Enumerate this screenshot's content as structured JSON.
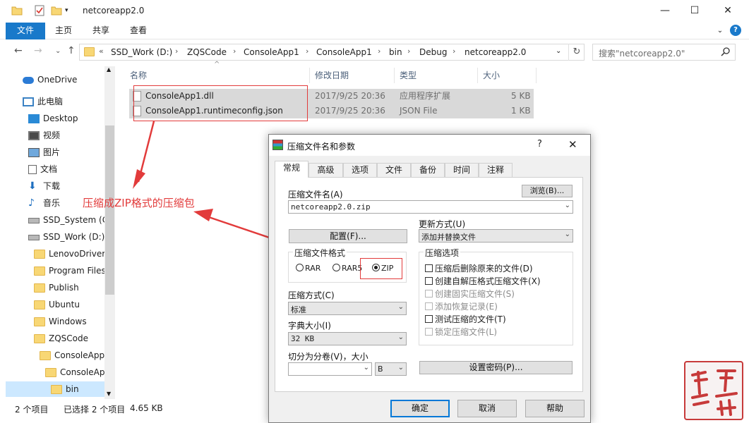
{
  "window": {
    "title": "netcoreapp2.0",
    "controls": {
      "minimize": "—",
      "maximize": "☐",
      "close": "✕"
    }
  },
  "ribbon": {
    "tabs": [
      "文件",
      "主页",
      "共享",
      "查看"
    ],
    "expand_icon": "chevron-down-icon",
    "help_icon": "help-icon"
  },
  "address": {
    "crumbs": [
      "SSD_Work (D:)",
      "ZQSCode",
      "ConsoleApp1",
      "ConsoleApp1",
      "bin",
      "Debug",
      "netcoreapp2.0"
    ],
    "overflow": "«"
  },
  "search": {
    "placeholder": "搜索\"netcoreapp2.0\""
  },
  "sidebar": {
    "items": [
      {
        "label": "OneDrive",
        "icon": "cloud-icon"
      },
      {
        "label": "此电脑",
        "icon": "computer-icon"
      },
      {
        "label": "Desktop",
        "icon": "desktop-folder-icon"
      },
      {
        "label": "视频",
        "icon": "video-folder-icon"
      },
      {
        "label": "图片",
        "icon": "pictures-folder-icon"
      },
      {
        "label": "文档",
        "icon": "documents-folder-icon"
      },
      {
        "label": "下载",
        "icon": "download-icon"
      },
      {
        "label": "音乐",
        "icon": "music-icon"
      },
      {
        "label": "SSD_System (C",
        "icon": "drive-icon"
      },
      {
        "label": "SSD_Work (D:)",
        "icon": "drive-icon"
      },
      {
        "label": "LenovoDriver",
        "icon": "folder-icon"
      },
      {
        "label": "Program Files",
        "icon": "folder-icon"
      },
      {
        "label": "Publish",
        "icon": "folder-icon"
      },
      {
        "label": "Ubuntu",
        "icon": "folder-icon"
      },
      {
        "label": "Windows",
        "icon": "folder-icon"
      },
      {
        "label": "ZQSCode",
        "icon": "folder-icon"
      },
      {
        "label": "ConsoleApp",
        "icon": "folder-icon"
      },
      {
        "label": "ConsoleAp",
        "icon": "folder-icon"
      },
      {
        "label": "bin",
        "icon": "folder-icon"
      }
    ]
  },
  "filelist": {
    "columns": [
      "名称",
      "修改日期",
      "类型",
      "大小"
    ],
    "rows": [
      {
        "name": "ConsoleApp1.dll",
        "date": "2017/9/25 20:36",
        "type": "应用程序扩展",
        "size": "5 KB"
      },
      {
        "name": "ConsoleApp1.runtimeconfig.json",
        "date": "2017/9/25 20:36",
        "type": "JSON File",
        "size": "1 KB"
      }
    ]
  },
  "status": {
    "count": "2 个项目",
    "selected": "已选择 2 个项目",
    "size": "4.65 KB"
  },
  "annotation": {
    "text": "压缩成ZIP格式的压缩包",
    "color": "#e23b3b"
  },
  "dialog": {
    "title": "压缩文件名和参数",
    "help": "?",
    "close": "✕",
    "tabs": [
      "常规",
      "高级",
      "选项",
      "文件",
      "备份",
      "时间",
      "注释"
    ],
    "archive_name_label": "压缩文件名(A)",
    "archive_name": "netcoreapp2.0.zip",
    "browse": "浏览(B)...",
    "update_label": "更新方式(U)",
    "update_value": "添加并替换文件",
    "profiles": "配置(F)...",
    "format_group": "压缩文件格式",
    "formats": [
      "RAR",
      "RAR5",
      "ZIP"
    ],
    "selected_format": "ZIP",
    "method_label": "压缩方式(C)",
    "method_value": "标准",
    "dict_label": "字典大小(I)",
    "dict_value": "32 KB",
    "split_label": "切分为分卷(V)，大小",
    "split_value": "",
    "split_unit": "B",
    "password": "设置密码(P)...",
    "options_group": "压缩选项",
    "options": [
      {
        "label": "压缩后删除原来的文件(D)",
        "enabled": true
      },
      {
        "label": "创建自解压格式压缩文件(X)",
        "enabled": true
      },
      {
        "label": "创建固实压缩文件(S)",
        "enabled": false
      },
      {
        "label": "添加恢复记录(E)",
        "enabled": false
      },
      {
        "label": "测试压缩的文件(T)",
        "enabled": true
      },
      {
        "label": "锁定压缩文件(L)",
        "enabled": false
      }
    ],
    "ok": "确定",
    "cancel": "取消",
    "help_btn": "帮助"
  },
  "watermark": {
    "text": "蜀山 油 年"
  },
  "colors": {
    "accent": "#1979ca",
    "selection": "#cce8ff",
    "annotation": "#e23b3b"
  }
}
